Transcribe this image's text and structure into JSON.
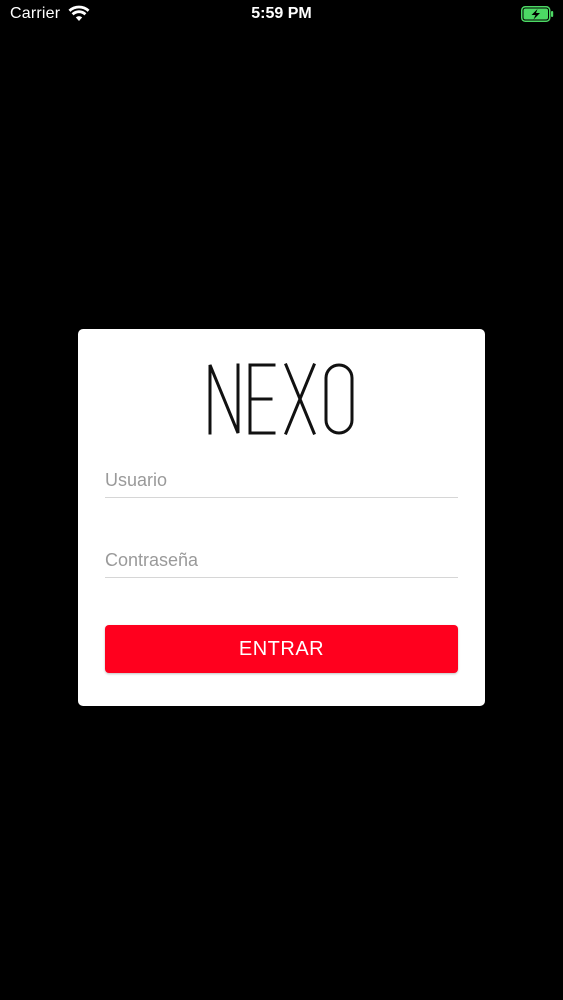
{
  "status_bar": {
    "carrier": "Carrier",
    "time": "5:59 PM",
    "wifi_icon": "wifi-icon",
    "battery_icon": "battery-charging-icon",
    "battery_color": "#4cd964"
  },
  "login": {
    "logo_text": "NEXO",
    "username": {
      "placeholder": "Usuario",
      "value": ""
    },
    "password": {
      "placeholder": "Contraseña",
      "value": ""
    },
    "submit_label": "ENTRAR",
    "button_color": "#ff001e"
  }
}
